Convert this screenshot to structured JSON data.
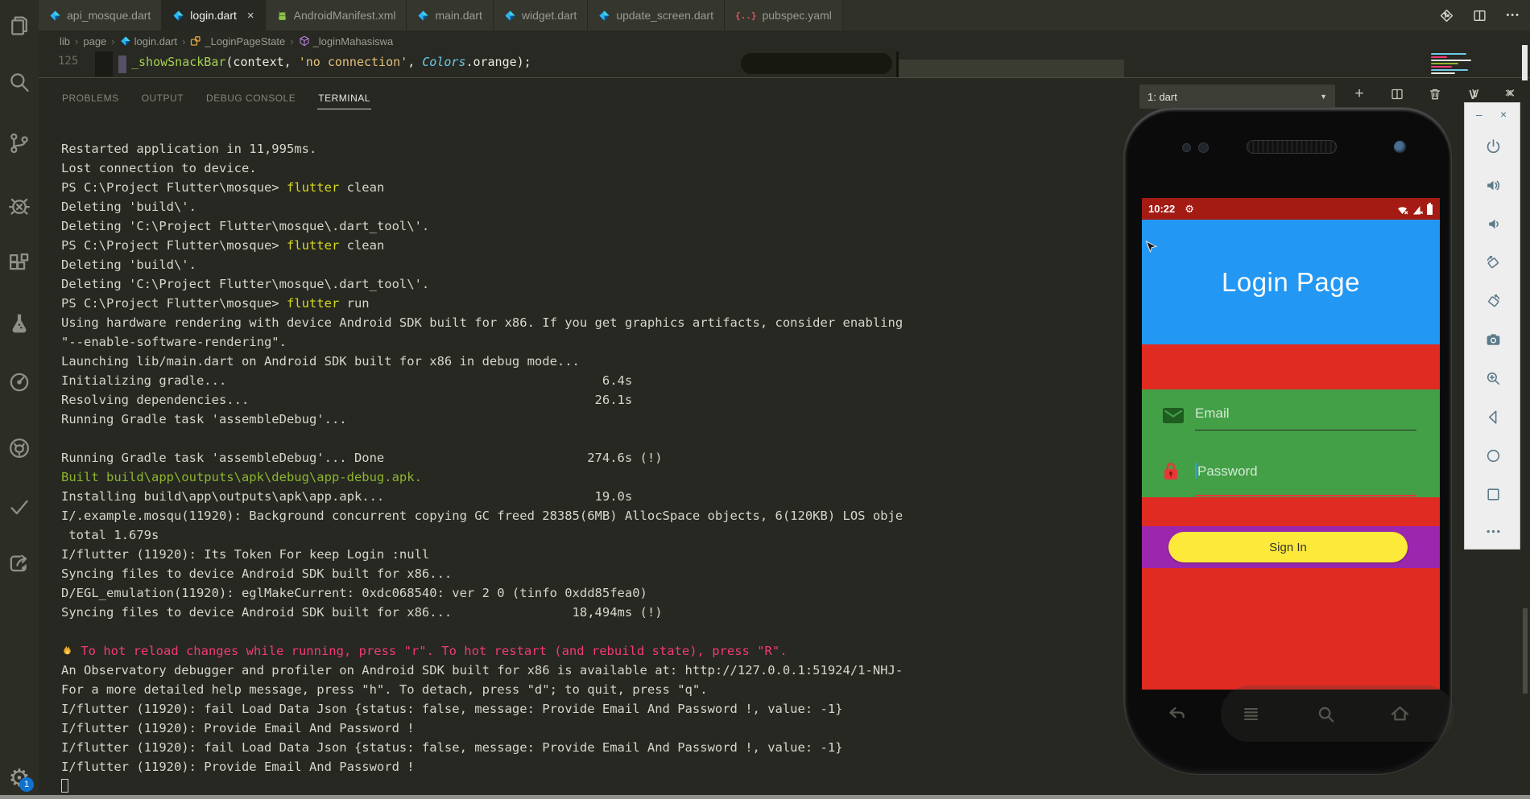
{
  "activity_bar": {
    "icons": [
      {
        "name": "explorer"
      },
      {
        "name": "search"
      },
      {
        "name": "source-control"
      },
      {
        "name": "debug"
      },
      {
        "name": "extensions"
      },
      {
        "name": "test-flask"
      },
      {
        "name": "dial"
      },
      {
        "name": "github"
      },
      {
        "name": "check"
      },
      {
        "name": "share"
      }
    ],
    "settings": {
      "name": "settings-gear",
      "glyph": "⚙",
      "badge": "1"
    }
  },
  "tabs": [
    {
      "label": "api_mosque.dart",
      "icon": "dart",
      "active": false,
      "close": false
    },
    {
      "label": "login.dart",
      "icon": "dart",
      "active": true,
      "close": true
    },
    {
      "label": "AndroidManifest.xml",
      "icon": "android",
      "active": false,
      "close": false
    },
    {
      "label": "main.dart",
      "icon": "dart",
      "active": false,
      "close": false
    },
    {
      "label": "widget.dart",
      "icon": "dart",
      "active": false,
      "close": false
    },
    {
      "label": "update_screen.dart",
      "icon": "dart",
      "active": false,
      "close": false
    },
    {
      "label": "pubspec.yaml",
      "icon": "yaml",
      "active": false,
      "close": false
    }
  ],
  "editor_actions": [
    {
      "name": "open-changes"
    },
    {
      "name": "split-editor"
    },
    {
      "name": "more-actions"
    }
  ],
  "breadcrumb": [
    {
      "label": "lib",
      "icon": null
    },
    {
      "label": "page",
      "icon": null
    },
    {
      "label": "login.dart",
      "icon": "dart"
    },
    {
      "label": "_LoginPageState",
      "icon": "class"
    },
    {
      "label": "_loginMahasiswa",
      "icon": "method"
    }
  ],
  "code_line": {
    "number": "125",
    "tokens": [
      {
        "t": "_showSnackBar",
        "c": "fn"
      },
      {
        "t": "(context, ",
        "c": "w"
      },
      {
        "t": "'no connection'",
        "c": "str"
      },
      {
        "t": ", ",
        "c": "w"
      },
      {
        "t": "Colors",
        "c": "cls"
      },
      {
        "t": ".orange);",
        "c": "w"
      }
    ]
  },
  "panel": {
    "tabs": [
      {
        "label": "PROBLEMS",
        "active": false
      },
      {
        "label": "OUTPUT",
        "active": false
      },
      {
        "label": "DEBUG CONSOLE",
        "active": false
      },
      {
        "label": "TERMINAL",
        "active": true
      }
    ],
    "terminal_select": {
      "value": "1: dart",
      "caret": "▼"
    },
    "actions": [
      {
        "name": "new-terminal",
        "glyph": "+"
      },
      {
        "name": "split-terminal",
        "glyph": null
      },
      {
        "name": "kill-terminal",
        "glyph": null
      },
      {
        "name": "maximize-panel",
        "glyph": "∨"
      },
      {
        "name": "close-panel",
        "glyph": "×"
      }
    ]
  },
  "terminal": {
    "lines": [
      [
        {
          "t": "Restarted application in 11,995ms."
        }
      ],
      [
        {
          "t": "Lost connection to device."
        }
      ],
      [
        {
          "t": "PS C:\\Project Flutter\\mosque> "
        },
        {
          "t": "flutter",
          "c": "y"
        },
        {
          "t": " clean"
        }
      ],
      [
        {
          "t": "Deleting 'build\\'."
        }
      ],
      [
        {
          "t": "Deleting 'C:\\Project Flutter\\mosque\\.dart_tool\\'."
        }
      ],
      [
        {
          "t": "PS C:\\Project Flutter\\mosque> "
        },
        {
          "t": "flutter",
          "c": "y"
        },
        {
          "t": " clean"
        }
      ],
      [
        {
          "t": "Deleting 'build\\'."
        }
      ],
      [
        {
          "t": "Deleting 'C:\\Project Flutter\\mosque\\.dart_tool\\'."
        }
      ],
      [
        {
          "t": "PS C:\\Project Flutter\\mosque> "
        },
        {
          "t": "flutter",
          "c": "y"
        },
        {
          "t": " run"
        }
      ],
      [
        {
          "t": "Using hardware rendering with device Android SDK built for x86. If you get graphics artifacts, consider enabling"
        }
      ],
      [
        {
          "t": "\"--enable-software-rendering\"."
        }
      ],
      [
        {
          "t": "Launching lib/main.dart on Android SDK built for x86 in debug mode..."
        }
      ],
      [
        {
          "t": "Initializing gradle...                                                  6.4s"
        }
      ],
      [
        {
          "t": "Resolving dependencies...                                              26.1s"
        }
      ],
      [
        {
          "t": "Running Gradle task 'assembleDebug'..."
        }
      ],
      [],
      [
        {
          "t": "Running Gradle task 'assembleDebug'... Done                           274.6s (!)"
        }
      ],
      [
        {
          "t": "Built build\\app\\outputs\\apk\\debug\\app-debug.apk.",
          "c": "g"
        }
      ],
      [
        {
          "t": "Installing build\\app\\outputs\\apk\\app.apk...                            19.0s"
        }
      ],
      [
        {
          "t": "I/.example.mosqu(11920): Background concurrent copying GC freed 28385(6MB) AllocSpace objects, 6(120KB) LOS obje"
        }
      ],
      [
        {
          "t": " total 1.679s"
        }
      ],
      [
        {
          "t": "I/flutter (11920): Its Token For keep Login :null"
        }
      ],
      [
        {
          "t": "Syncing files to device Android SDK built for x86..."
        }
      ],
      [
        {
          "t": "D/EGL_emulation(11920): eglMakeCurrent: 0xdc068540: ver 2 0 (tinfo 0xdd85fea0)"
        }
      ],
      [
        {
          "t": "Syncing files to device Android SDK built for x86...                18,494ms (!)"
        }
      ],
      [],
      [
        {
          "i": "flame"
        },
        {
          "t": " To hot reload changes while running, press \"r\". To hot restart (and rebuild state), press \"R\".",
          "c": "p"
        }
      ],
      [
        {
          "t": "An Observatory debugger and profiler on Android SDK built for x86 is available at: http://127.0.0.1:51924/1-NHJ-"
        }
      ],
      [
        {
          "t": "For a more detailed help message, press \"h\". To detach, press \"d\"; to quit, press \"q\"."
        }
      ],
      [
        {
          "t": "I/flutter (11920): fail Load Data Json {status: false, message: Provide Email And Password !, value: -1}"
        }
      ],
      [
        {
          "t": "I/flutter (11920): Provide Email And Password !"
        }
      ],
      [
        {
          "t": "I/flutter (11920): fail Load Data Json {status: false, message: Provide Email And Password !, value: -1}"
        }
      ],
      [
        {
          "t": "I/flutter (11920): Provide Email And Password !"
        }
      ],
      [
        {
          "i": "cursor"
        }
      ]
    ]
  },
  "emulator": {
    "statusbar": {
      "time": "10:22",
      "gear_glyph": "⚙",
      "icons": [
        "wifi-off-icon",
        "signal-off-icon",
        "battery-icon"
      ]
    },
    "app": {
      "title": "Login Page",
      "email_placeholder": "Email",
      "password_placeholder": "Password",
      "signin_label": "Sign In",
      "colors": {
        "statusbar": "#a31b12",
        "blue": "#2297f3",
        "red": "#e02b22",
        "green": "#43a047",
        "purple": "#9b27af",
        "yellow": "#fde93a"
      }
    },
    "nav": [
      {
        "name": "nav-back"
      },
      {
        "name": "nav-menu"
      },
      {
        "name": "nav-search"
      },
      {
        "name": "nav-home"
      }
    ],
    "toolbar": {
      "window_controls": [
        {
          "name": "emulator-minimize",
          "glyph": "–"
        },
        {
          "name": "emulator-close",
          "glyph": "×"
        }
      ],
      "icons": [
        {
          "name": "power"
        },
        {
          "name": "volume-up"
        },
        {
          "name": "volume-down"
        },
        {
          "name": "rotate-left"
        },
        {
          "name": "rotate-right"
        },
        {
          "name": "screenshot-camera"
        },
        {
          "name": "zoom"
        },
        {
          "name": "emu-back"
        },
        {
          "name": "emu-home"
        },
        {
          "name": "emu-overview"
        },
        {
          "name": "emu-more"
        }
      ]
    }
  }
}
